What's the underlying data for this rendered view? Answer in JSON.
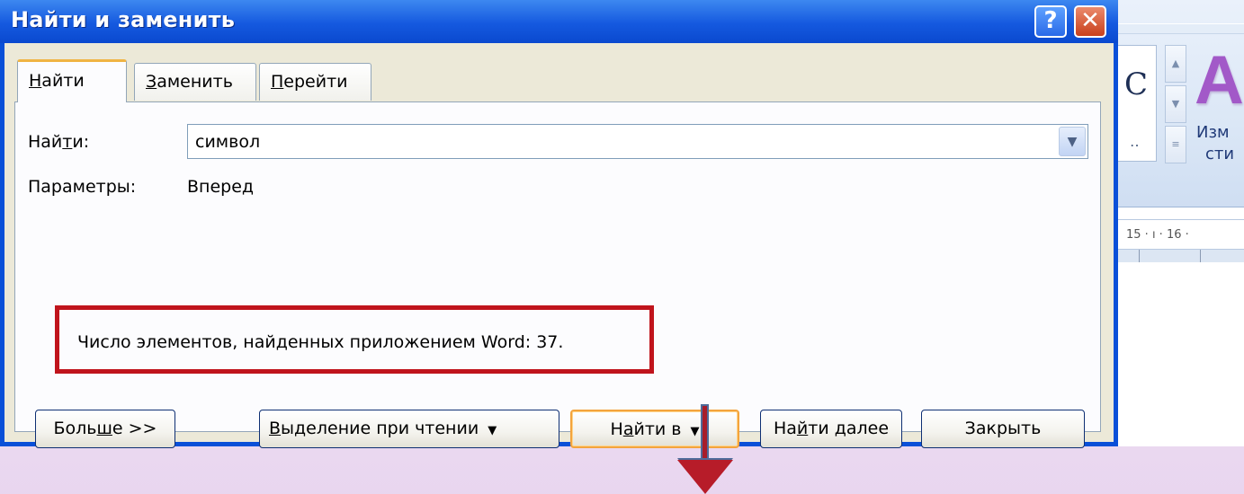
{
  "window": {
    "title": "Найти и заменить",
    "help_glyph": "?",
    "close_glyph": "✕"
  },
  "tabs": [
    {
      "label": "Найти",
      "mnemonic": "Н",
      "rest": "айти",
      "active": true
    },
    {
      "label": "Заменить",
      "mnemonic": "З",
      "rest": "аменить",
      "active": false
    },
    {
      "label": "Перейти",
      "mnemonic": "П",
      "rest": "ерейти",
      "active": false
    }
  ],
  "find": {
    "label_pre": "Най",
    "label_mnemonic": "т",
    "label_post": "и:",
    "value": "символ",
    "arrow_glyph": "▼"
  },
  "params": {
    "label": "Параметры:",
    "value": "Вперед"
  },
  "notice": {
    "text": "Число элементов, найденных приложением Word: 37."
  },
  "buttons": {
    "more_pre": "Боль",
    "more_mnemonic": "ш",
    "more_post": "е >>",
    "highlight_mnemonic": "В",
    "highlight_post": "ыделение при чтении",
    "findin_pre": "Н",
    "findin_mnemonic": "а",
    "findin_post": "йти в",
    "findnext_pre": "На",
    "findnext_mnemonic": "й",
    "findnext_post": "ти далее",
    "close_label": "Закрыть",
    "dropdown_glyph": "▼"
  },
  "word_background": {
    "style_preview": "C",
    "style_dots": "‥",
    "big_letter": "A",
    "change_style_line1": "Изм",
    "change_style_line2": "сти",
    "ruler_text": "15 · ı · 16 ·",
    "colors": {
      "ribbon": "#dbe7f6",
      "accent_letter": "#a259c8"
    }
  },
  "annotation": {
    "box_color": "#c0141c",
    "arrow_color": "#b71c29"
  }
}
